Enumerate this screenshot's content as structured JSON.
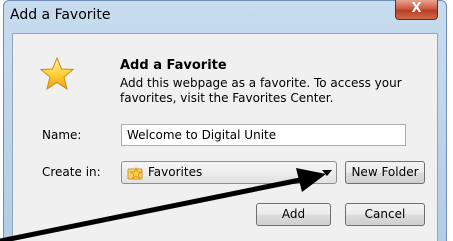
{
  "window": {
    "title": "Add a Favorite",
    "close_glyph": "X"
  },
  "header": {
    "heading": "Add a Favorite",
    "description": "Add this webpage as a favorite. To access your favorites, visit the Favorites Center.",
    "icon": "star-icon"
  },
  "form": {
    "name_label": "Name:",
    "name_value": "Welcome to Digital Unite",
    "create_in_label": "Create in:",
    "create_in_value": "Favorites",
    "create_in_icon": "folder-star-icon"
  },
  "buttons": {
    "new_folder": "New Folder",
    "add": "Add",
    "cancel": "Cancel"
  },
  "annotation": {
    "arrow_color": "#000000"
  }
}
